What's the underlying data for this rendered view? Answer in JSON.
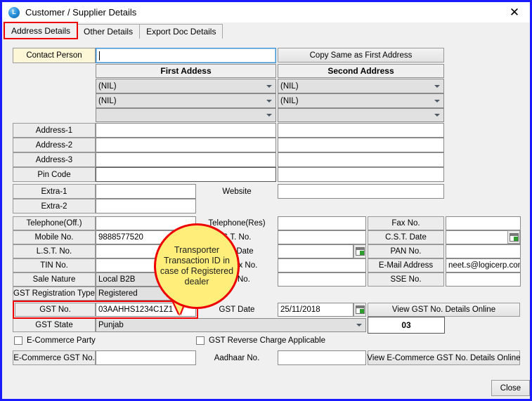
{
  "window": {
    "title": "Customer / Supplier Details",
    "app_icon": "L",
    "close_label": "✕"
  },
  "tabs": [
    {
      "label": "Address Details",
      "active": true
    },
    {
      "label": "Other Details",
      "active": false
    },
    {
      "label": "Export Doc Details",
      "active": false
    }
  ],
  "address": {
    "contact_person_label": "Contact Person",
    "contact_person_value": "",
    "copy_button": "Copy Same as First Address",
    "col1_header": "First Addess",
    "col2_header": "Second Address",
    "dropdowns": [
      {
        "first": "(NIL)",
        "second": "(NIL)"
      },
      {
        "first": "(NIL)",
        "second": "(NIL)"
      },
      {
        "first": "",
        "second": ""
      }
    ],
    "rows": [
      {
        "label": "Address-1",
        "first": "",
        "second": ""
      },
      {
        "label": "Address-2",
        "first": "",
        "second": ""
      },
      {
        "label": "Address-3",
        "first": "",
        "second": ""
      },
      {
        "label": "Pin Code",
        "first": "",
        "second": ""
      }
    ],
    "extra1_label": "Extra-1",
    "extra1_value": "",
    "extra2_label": "Extra-2",
    "extra2_value": "",
    "website_label": "Website",
    "website_value": ""
  },
  "contact": {
    "left": [
      {
        "label": "Telephone(Off.)",
        "value": ""
      },
      {
        "label": "Mobile No.",
        "value": "9888577520"
      },
      {
        "label": "L.S.T. No.",
        "value": ""
      },
      {
        "label": "TIN No.",
        "value": ""
      },
      {
        "label": "Sale Nature",
        "value": "Local B2B"
      },
      {
        "label": "GST Registration Type",
        "value": "Registered"
      }
    ],
    "mid": [
      {
        "label": "Telephone(Res)",
        "value": ""
      },
      {
        "label": "S.T. No.",
        "value": ""
      },
      {
        "label": "S.T. Date",
        "value": ""
      },
      {
        "label": "Ex. Tax No.",
        "value": ""
      },
      {
        "label": "Ex. No.",
        "value": ""
      }
    ],
    "right": [
      {
        "label": "Fax No.",
        "value": ""
      },
      {
        "label": "C.S.T. Date",
        "value": ""
      },
      {
        "label": "PAN No.",
        "value": ""
      },
      {
        "label": "E-Mail Address",
        "value": "neet.s@logicerp.com"
      },
      {
        "label": "SSE No.",
        "value": ""
      }
    ]
  },
  "gst": {
    "no_label": "GST No.",
    "no_value": "03AAHHS1234C1Z1",
    "date_label": "GST Date",
    "date_value": "25/11/2018",
    "view_online_button": "View GST No. Details Online",
    "state_label": "GST State",
    "state_value": "Punjab",
    "state_code": "03"
  },
  "ecommerce": {
    "party_checkbox": "E-Commerce Party",
    "party_checked": false,
    "reverse_charge_checkbox": "GST Reverse Charge Applicable",
    "reverse_charge_checked": false,
    "gst_no_label": "E-Commerce GST No.",
    "gst_no_value": "",
    "aadhaar_label": "Aadhaar No.",
    "aadhaar_value": "",
    "view_online_button": "View E-Commerce GST No. Details Online"
  },
  "callout": {
    "text": "Transporter Transaction ID in case of Registered dealer"
  },
  "footer": {
    "close_button": "Close"
  },
  "colors": {
    "window_border": "#1a1aff",
    "highlight": "#ee0000",
    "callout_fill": "#ffef7a",
    "label_bg": "#ececed",
    "cream_bg": "#fdf7d7"
  }
}
